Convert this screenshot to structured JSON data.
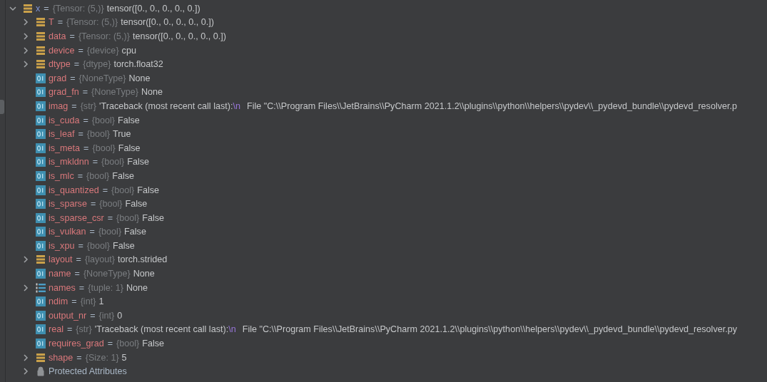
{
  "variables": [
    {
      "name": "x",
      "operator": "=",
      "type": "{Tensor: (5,)}",
      "value": "tensor([0., 0., 0., 0., 0.])",
      "kind": "object",
      "expanded": true,
      "children": [
        {
          "name": "T",
          "operator": "=",
          "type": "{Tensor: (5,)}",
          "value": "tensor([0., 0., 0., 0., 0.])",
          "kind": "object",
          "expanded": false
        },
        {
          "name": "data",
          "operator": "=",
          "type": "{Tensor: (5,)}",
          "value": "tensor([0., 0., 0., 0., 0.])",
          "kind": "object",
          "expanded": false
        },
        {
          "name": "device",
          "operator": "=",
          "type": "{device}",
          "value": "cpu",
          "kind": "object",
          "expanded": false
        },
        {
          "name": "dtype",
          "operator": "=",
          "type": "{dtype}",
          "value": "torch.float32",
          "kind": "object",
          "expanded": false
        },
        {
          "name": "grad",
          "operator": "=",
          "type": "{NoneType}",
          "value": "None",
          "kind": "field"
        },
        {
          "name": "grad_fn",
          "operator": "=",
          "type": "{NoneType}",
          "value": "None",
          "kind": "field"
        },
        {
          "name": "imag",
          "operator": "=",
          "type": "{str}",
          "value": "'Traceback (most recent call last):",
          "escape": "\\n",
          "value_rest": "File \"C:\\\\Program Files\\\\JetBrains\\\\PyCharm 2021.1.2\\\\plugins\\\\python\\\\helpers\\\\pydev\\\\_pydevd_bundle\\\\pydevd_resolver.p",
          "kind": "field"
        },
        {
          "name": "is_cuda",
          "operator": "=",
          "type": "{bool}",
          "value": "False",
          "kind": "field"
        },
        {
          "name": "is_leaf",
          "operator": "=",
          "type": "{bool}",
          "value": "True",
          "kind": "field"
        },
        {
          "name": "is_meta",
          "operator": "=",
          "type": "{bool}",
          "value": "False",
          "kind": "field"
        },
        {
          "name": "is_mkldnn",
          "operator": "=",
          "type": "{bool}",
          "value": "False",
          "kind": "field"
        },
        {
          "name": "is_mlc",
          "operator": "=",
          "type": "{bool}",
          "value": "False",
          "kind": "field"
        },
        {
          "name": "is_quantized",
          "operator": "=",
          "type": "{bool}",
          "value": "False",
          "kind": "field"
        },
        {
          "name": "is_sparse",
          "operator": "=",
          "type": "{bool}",
          "value": "False",
          "kind": "field"
        },
        {
          "name": "is_sparse_csr",
          "operator": "=",
          "type": "{bool}",
          "value": "False",
          "kind": "field"
        },
        {
          "name": "is_vulkan",
          "operator": "=",
          "type": "{bool}",
          "value": "False",
          "kind": "field"
        },
        {
          "name": "is_xpu",
          "operator": "=",
          "type": "{bool}",
          "value": "False",
          "kind": "field"
        },
        {
          "name": "layout",
          "operator": "=",
          "type": "{layout}",
          "value": "torch.strided",
          "kind": "object",
          "expanded": false
        },
        {
          "name": "name",
          "operator": "=",
          "type": "{NoneType}",
          "value": "None",
          "kind": "field"
        },
        {
          "name": "names",
          "operator": "=",
          "type": "{tuple: 1}",
          "value": "None",
          "kind": "list",
          "expanded": false
        },
        {
          "name": "ndim",
          "operator": "=",
          "type": "{int}",
          "value": "1",
          "kind": "field"
        },
        {
          "name": "output_nr",
          "operator": "=",
          "type": "{int}",
          "value": "0",
          "kind": "field"
        },
        {
          "name": "real",
          "operator": "=",
          "type": "{str}",
          "value": "'Traceback (most recent call last):",
          "escape": "\\n",
          "value_rest": "File \"C:\\\\Program Files\\\\JetBrains\\\\PyCharm 2021.1.2\\\\plugins\\\\python\\\\helpers\\\\pydev\\\\_pydevd_bundle\\\\pydevd_resolver.py",
          "kind": "field"
        },
        {
          "name": "requires_grad",
          "operator": "=",
          "type": "{bool}",
          "value": "False",
          "kind": "field"
        },
        {
          "name": "shape",
          "operator": "=",
          "type": "{Size: 1}",
          "value": "5",
          "kind": "object",
          "expanded": false
        },
        {
          "name": "Protected Attributes",
          "kind": "group",
          "expanded": false
        }
      ]
    }
  ]
}
